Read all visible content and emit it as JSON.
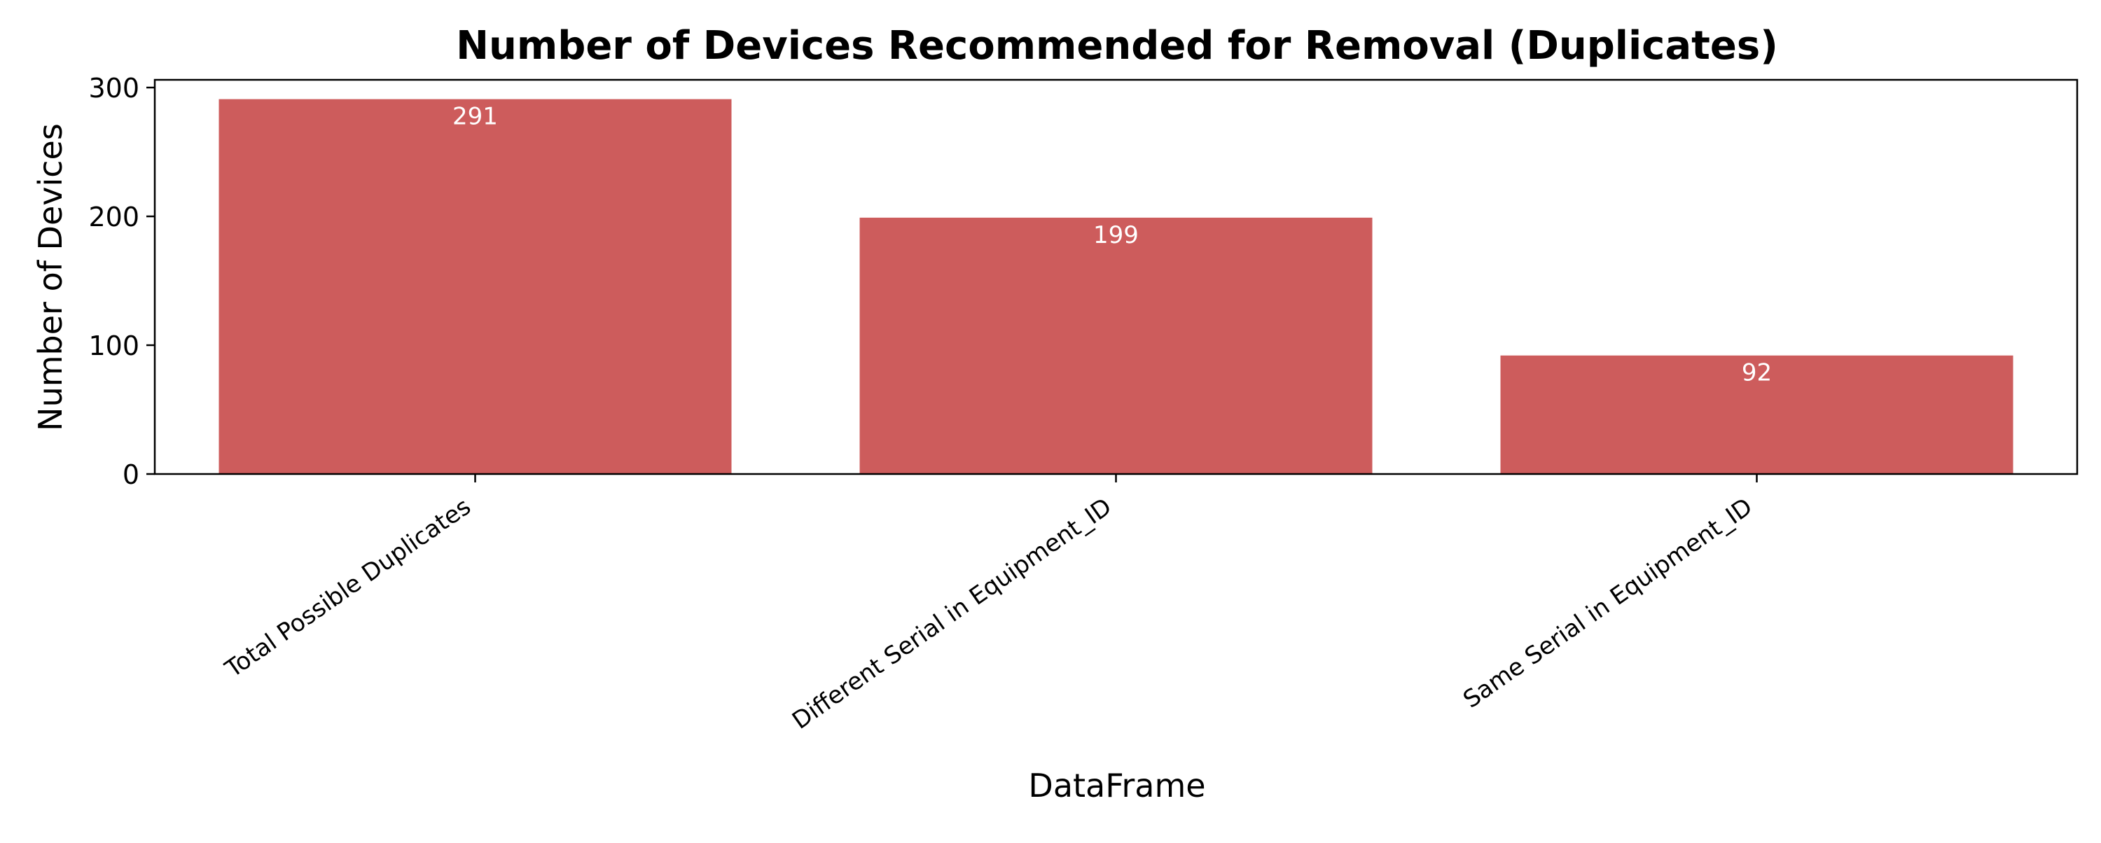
{
  "chart_data": {
    "type": "bar",
    "title": "Number of Devices Recommended for Removal (Duplicates)",
    "xlabel": "DataFrame",
    "ylabel": "Number of Devices",
    "categories": [
      "Total Possible Duplicates",
      "Different Serial in Equipment_ID",
      "Same Serial in Equipment_ID"
    ],
    "values": [
      291,
      199,
      92
    ],
    "value_labels": [
      "291",
      "199",
      "92"
    ],
    "ylim": [
      0,
      306
    ],
    "yticks": [
      0,
      100,
      200,
      300
    ],
    "ytick_labels": [
      "0",
      "100",
      "200",
      "300"
    ],
    "grid": false,
    "legend": "none",
    "bar_color": "#cd5c5c",
    "value_label_color": "#ffffff",
    "xtick_rotation_deg": -35
  }
}
